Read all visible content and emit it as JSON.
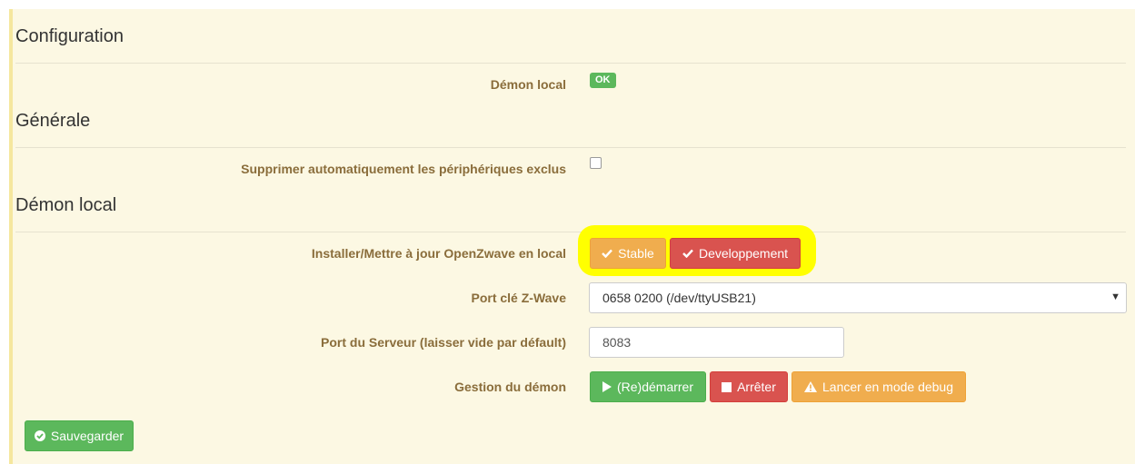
{
  "sections": {
    "configuration": "Configuration",
    "generale": "Générale",
    "demon_local": "Démon local"
  },
  "rows": {
    "demon_local_label": "Démon local",
    "demon_status": "OK",
    "auto_delete_label": "Supprimer automatiquement les périphériques exclus",
    "auto_delete_checked": false,
    "install_label": "Installer/Mettre à jour OpenZwave en local",
    "port_label": "Port clé Z-Wave",
    "server_port_label": "Port du Serveur (laisser vide par défault)",
    "daemon_mgmt_label": "Gestion du démon"
  },
  "buttons": {
    "stable": "Stable",
    "developpement": "Developpement",
    "restart": "(Re)démarrer",
    "stop": "Arrêter",
    "debug": "Lancer en mode debug",
    "save": "Sauvegarder"
  },
  "fields": {
    "zwave_port_selected": "0658 0200 (/dev/ttyUSB21)",
    "server_port_placeholder": "8083"
  },
  "icons": {
    "stable": "check-icon",
    "developpement": "check-icon",
    "restart": "play-icon",
    "stop": "stop-icon",
    "debug": "warning-icon",
    "save": "check-circle-icon"
  },
  "colors": {
    "panel_bg": "#fcf8e3",
    "label_text": "#8a6d3b",
    "success": "#5cb85c",
    "danger": "#d9534f",
    "warning": "#f0ad4e",
    "highlight": "#ffff00"
  }
}
